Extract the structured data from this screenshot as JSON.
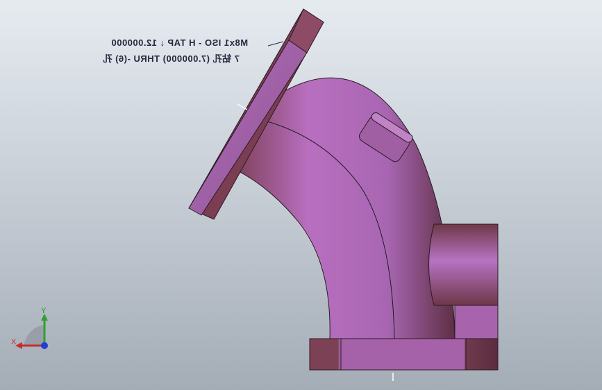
{
  "annotation": {
    "line1": "M8x1 ISO - H TAP ↓ 12.000000",
    "line2": "7 钻孔 (7.000000) THRU -(6) 孔"
  },
  "triad": {
    "x_label": "X",
    "y_label": "Y"
  },
  "colors": {
    "part_light": "#b36ebd",
    "part_mid": "#9a5a8e",
    "part_dark": "#6e3849",
    "edge": "#1c1c24"
  }
}
